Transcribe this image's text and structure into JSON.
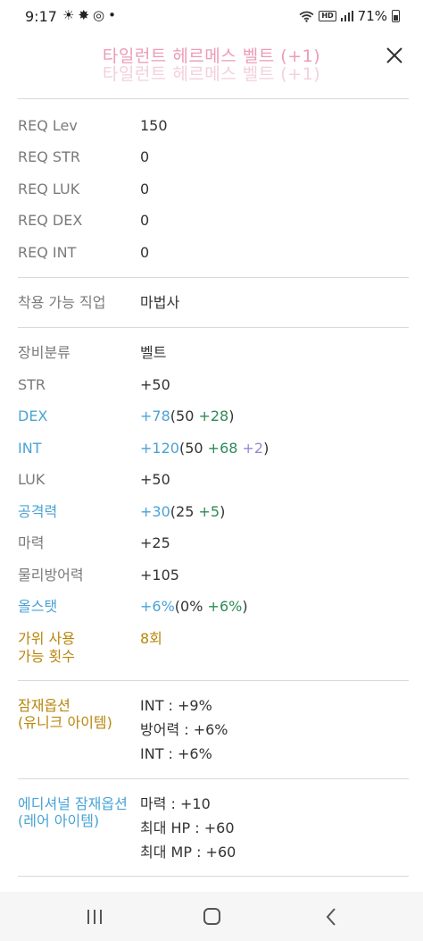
{
  "status": {
    "time": "9:17",
    "icons": [
      "sun-icon",
      "star-badge-icon",
      "target-icon",
      "dot-icon"
    ],
    "hd": "HD",
    "battery": "71%"
  },
  "header": {
    "title": "타일런트 헤르메스 벨트 (+1)",
    "close_label": "close"
  },
  "req": [
    {
      "label": "REQ Lev",
      "value": "150"
    },
    {
      "label": "REQ STR",
      "value": "0"
    },
    {
      "label": "REQ LUK",
      "value": "0"
    },
    {
      "label": "REQ DEX",
      "value": "0"
    },
    {
      "label": "REQ INT",
      "value": "0"
    }
  ],
  "job": {
    "label": "착용 가능 직업",
    "value": "마법사"
  },
  "stats": {
    "category": {
      "label": "장비분류",
      "value": "벨트"
    },
    "str": {
      "label": "STR",
      "value": "+50"
    },
    "dex": {
      "label": "DEX",
      "total": "+78",
      "open": "(",
      "base": "50",
      "bonus": "+28",
      "close": ")"
    },
    "int": {
      "label": "INT",
      "total": "+120",
      "open": "(",
      "base": "50",
      "bonus": "+68",
      "enhance": "+2",
      "close": ")"
    },
    "luk": {
      "label": "LUK",
      "value": "+50"
    },
    "att": {
      "label": "공격력",
      "total": "+30",
      "open": "(",
      "base": "25",
      "bonus": "+5",
      "close": ")"
    },
    "matt": {
      "label": "마력",
      "value": "+25"
    },
    "def": {
      "label": "물리방어력",
      "value": "+105"
    },
    "allstat": {
      "label": "올스탯",
      "total": "+6%",
      "open": "(",
      "base": "0%",
      "bonus": "+6%",
      "close": ")"
    },
    "scissors": {
      "label_line1": "가위 사용",
      "label_line2": "가능 횟수",
      "value": "8회"
    }
  },
  "potential": {
    "label_line1": "잠재옵션",
    "label_line2": "(유니크 아이템)",
    "lines": [
      "INT : +9%",
      "방어력 : +6%",
      "INT : +6%"
    ]
  },
  "additional": {
    "label_line1": "에디셔널 잠재옵션",
    "label_line2": "(레어 아이템)",
    "lines": [
      "마력 : +10",
      "최대 HP : +60",
      "최대 MP : +60"
    ]
  },
  "colors": {
    "title": "#ec9bb8",
    "blue": "#4aa3d6",
    "green": "#2e8b57",
    "gold": "#b8860b",
    "purple": "#9b86d6"
  },
  "nav": [
    "recent-apps-icon",
    "home-icon",
    "back-icon"
  ]
}
